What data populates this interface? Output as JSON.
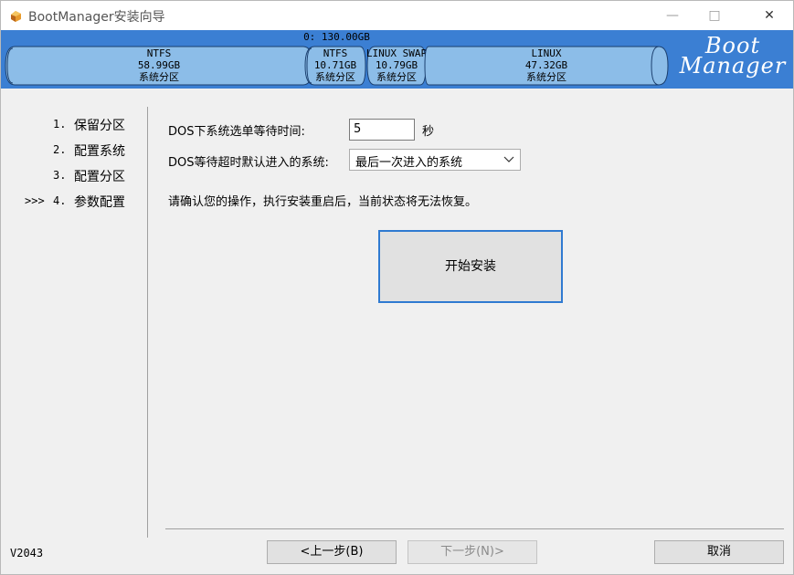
{
  "window": {
    "title": "BootManager安装向导",
    "controls": {
      "minimize": "—",
      "maximize": "□",
      "close": "✕"
    }
  },
  "disk": {
    "label": "0: 130.00GB",
    "partitions": [
      {
        "fs": "NTFS",
        "size": "58.99GB",
        "type": "系统分区"
      },
      {
        "fs": "NTFS",
        "size": "10.71GB",
        "type": "系统分区"
      },
      {
        "fs": "LINUX SWAP",
        "size": "10.79GB",
        "type": "系统分区"
      },
      {
        "fs": "LINUX",
        "size": "47.32GB",
        "type": "系统分区"
      }
    ]
  },
  "brand": {
    "line1": "Boot",
    "line2": "Manager"
  },
  "steps": [
    {
      "num": "1.",
      "label": "保留分区",
      "marker": ""
    },
    {
      "num": "2.",
      "label": "配置系统",
      "marker": ""
    },
    {
      "num": "3.",
      "label": "配置分区",
      "marker": ""
    },
    {
      "num": "4.",
      "label": "参数配置",
      "marker": ">>>"
    }
  ],
  "form": {
    "wait_label": "DOS下系统选单等待时间:",
    "wait_value": "5",
    "wait_unit": "秒",
    "default_label": "DOS等待超时默认进入的系统:",
    "default_value": "最后一次进入的系统",
    "confirm_text": "请确认您的操作，执行安装重启后，当前状态将无法恢复。",
    "install_button": "开始安装"
  },
  "footer": {
    "version": "V2043",
    "prev_button": "<上一步(B)",
    "next_button": "下一步(N)>",
    "cancel_button": "取消"
  },
  "colors": {
    "bar": "#3b7fd3",
    "partition": "#8cbde8",
    "accent": "#2f7ad1"
  }
}
